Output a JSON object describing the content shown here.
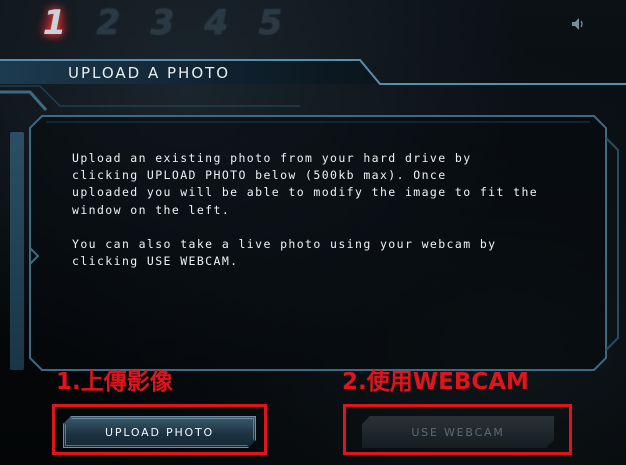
{
  "steps": [
    "1",
    "2",
    "3",
    "4",
    "5"
  ],
  "active_step": 1,
  "icons": {
    "sound": "speaker-icon"
  },
  "section": {
    "title": "UPLOAD A PHOTO"
  },
  "body": {
    "paragraph1": "Upload an existing photo from your hard drive by\nclicking UPLOAD PHOTO below (500kb max). Once\nuploaded you will be able to modify the image to fit the\nwindow on the left.",
    "paragraph2": "You can also take a live photo using your webcam by\nclicking USE WEBCAM."
  },
  "annotations": {
    "upload": "1.上傳影像",
    "webcam": "2.使用WEBCAM"
  },
  "buttons": {
    "upload_label": "UPLOAD PHOTO",
    "webcam_label": "USE WEBCAM"
  },
  "colors": {
    "annotation_red": "#e0141c",
    "panel_border": "#3d6a85",
    "active_step_glow": "#c41e1e"
  }
}
